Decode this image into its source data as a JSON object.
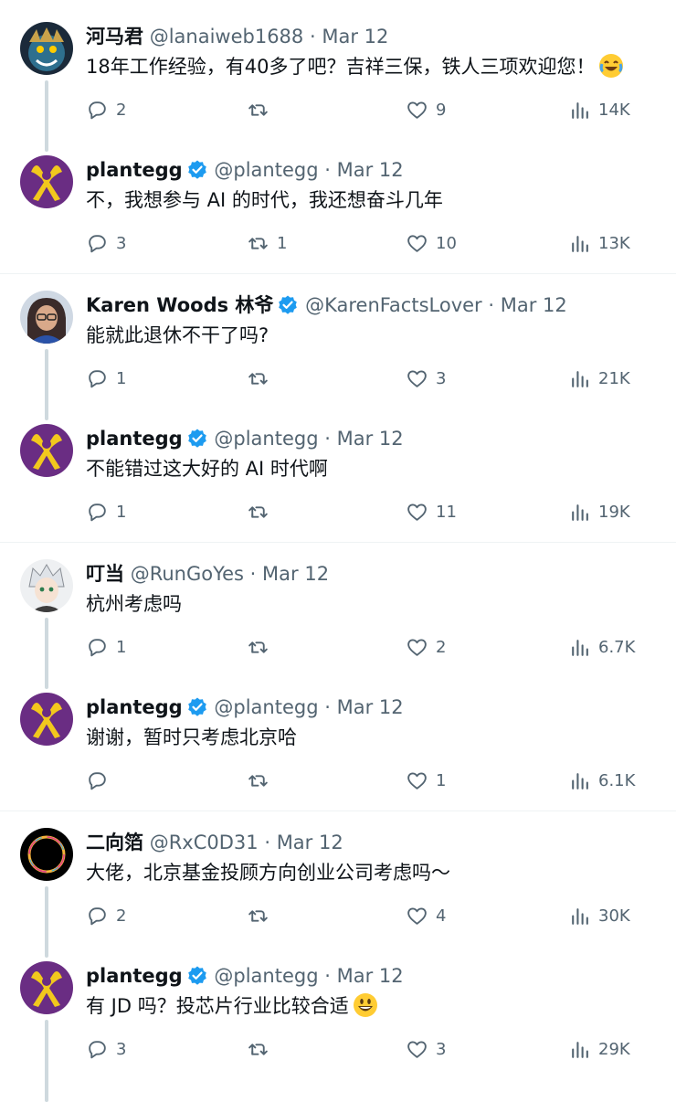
{
  "tweets": [
    {
      "name": "河马君",
      "handle": "@lanaiweb1688",
      "dot": "·",
      "date": "Mar 12",
      "text": "18年工作经验，有40多了吧？吉祥三保，铁人三项欢迎您！",
      "emoji": "joy",
      "replies": "2",
      "retweets": "",
      "likes": "9",
      "views": "14K",
      "verified": false,
      "avatar": "monster"
    },
    {
      "name": "plantegg",
      "handle": "@plantegg",
      "dot": "·",
      "date": "Mar 12",
      "text": "不，我想参与 AI 的时代，我还想奋斗几年",
      "replies": "3",
      "retweets": "1",
      "likes": "10",
      "views": "13K",
      "verified": true,
      "avatar": "ribbon"
    },
    {
      "name": "Karen Woods 林爷",
      "handle": "@KarenFactsLover",
      "dot": "·",
      "date": "Mar 12",
      "text": "能就此退休不干了吗?",
      "replies": "1",
      "retweets": "",
      "likes": "3",
      "views": "21K",
      "verified": true,
      "avatar": "woman"
    },
    {
      "name": "plantegg",
      "handle": "@plantegg",
      "dot": "·",
      "date": "Mar 12",
      "text": "不能错过这大好的 AI 时代啊",
      "replies": "1",
      "retweets": "",
      "likes": "11",
      "views": "19K",
      "verified": true,
      "avatar": "ribbon"
    },
    {
      "name": "叮当",
      "handle": "@RunGoYes",
      "dot": "·",
      "date": "Mar 12",
      "text": "杭州考虑吗",
      "replies": "1",
      "retweets": "",
      "likes": "2",
      "views": "6.7K",
      "verified": false,
      "avatar": "anime"
    },
    {
      "name": "plantegg",
      "handle": "@plantegg",
      "dot": "·",
      "date": "Mar 12",
      "text": "谢谢，暂时只考虑北京哈",
      "replies": "",
      "retweets": "",
      "likes": "1",
      "views": "6.1K",
      "verified": true,
      "avatar": "ribbon"
    },
    {
      "name": "二向箔",
      "handle": "@RxC0D31",
      "dot": "·",
      "date": "Mar 12",
      "text": "大佬，北京基金投顾方向创业公司考虑吗～",
      "replies": "2",
      "retweets": "",
      "likes": "4",
      "views": "30K",
      "verified": false,
      "avatar": "ring"
    },
    {
      "name": "plantegg",
      "handle": "@plantegg",
      "dot": "·",
      "date": "Mar 12",
      "text": "有 JD 吗？投芯片行业比较合适",
      "emoji": "smile",
      "replies": "3",
      "retweets": "",
      "likes": "3",
      "views": "29K",
      "verified": true,
      "avatar": "ribbon"
    }
  ],
  "colors": {
    "text": "#0f1419",
    "secondary": "#536471",
    "verified": "#1d9bf0",
    "line": "#cfd9de",
    "ribbon_bg": "#6a2d83",
    "ribbon": "#f2c81d"
  },
  "icons": {
    "reply": "reply-icon",
    "retweet": "retweet-icon",
    "like": "heart-icon",
    "views": "views-icon",
    "verified": "verified-badge-icon"
  }
}
